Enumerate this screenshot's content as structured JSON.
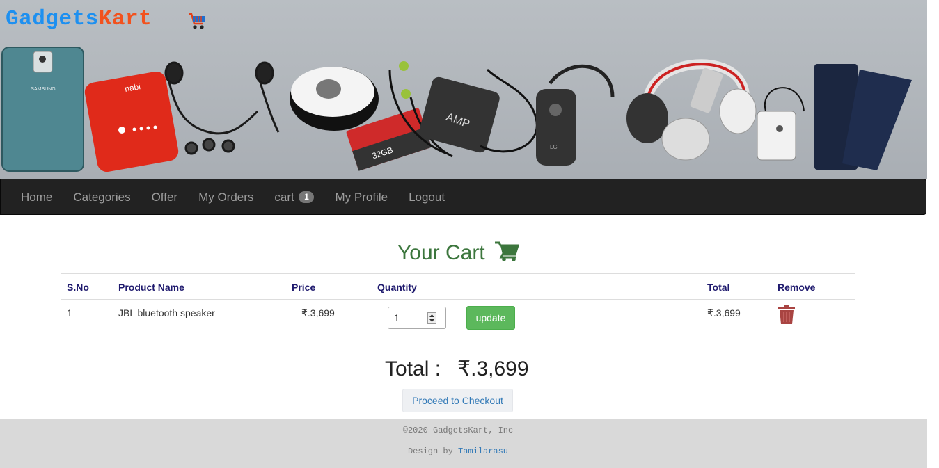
{
  "brand": {
    "name_part1": "Gadgets",
    "name_part2": "Kart",
    "color_part1": "#1e90f0",
    "color_part2": "#f2521e"
  },
  "banner": {
    "phone_label": "SAMSUNG",
    "powerbank_label": "nabi",
    "sdcard_label": "32GB",
    "charger_label": "AMP",
    "headset_label": "LG"
  },
  "nav": {
    "items": [
      {
        "label": "Home"
      },
      {
        "label": "Categories"
      },
      {
        "label": "Offer"
      },
      {
        "label": "My Orders"
      },
      {
        "label": "cart",
        "badge": "1"
      },
      {
        "label": "My Profile"
      },
      {
        "label": "Logout"
      }
    ]
  },
  "cart": {
    "title": "Your Cart",
    "title_color": "#3c763d",
    "columns": {
      "sno": "S.No",
      "product": "Product Name",
      "price": "Price",
      "quantity": "Quantity",
      "total": "Total",
      "remove": "Remove"
    },
    "rows": [
      {
        "sno": "1",
        "product": "JBL bluetooth speaker",
        "price": "₹.3,699",
        "quantity": "1",
        "update_label": "update",
        "total": "₹.3,699"
      }
    ],
    "grand_total_label": "Total :",
    "grand_total_value": "₹.3,699",
    "checkout_label": "Proceed to Checkout"
  },
  "footer": {
    "copyright": "©2020 GadgetsKart, Inc",
    "design_prefix": "Design by",
    "author": "Tamilarasu"
  }
}
